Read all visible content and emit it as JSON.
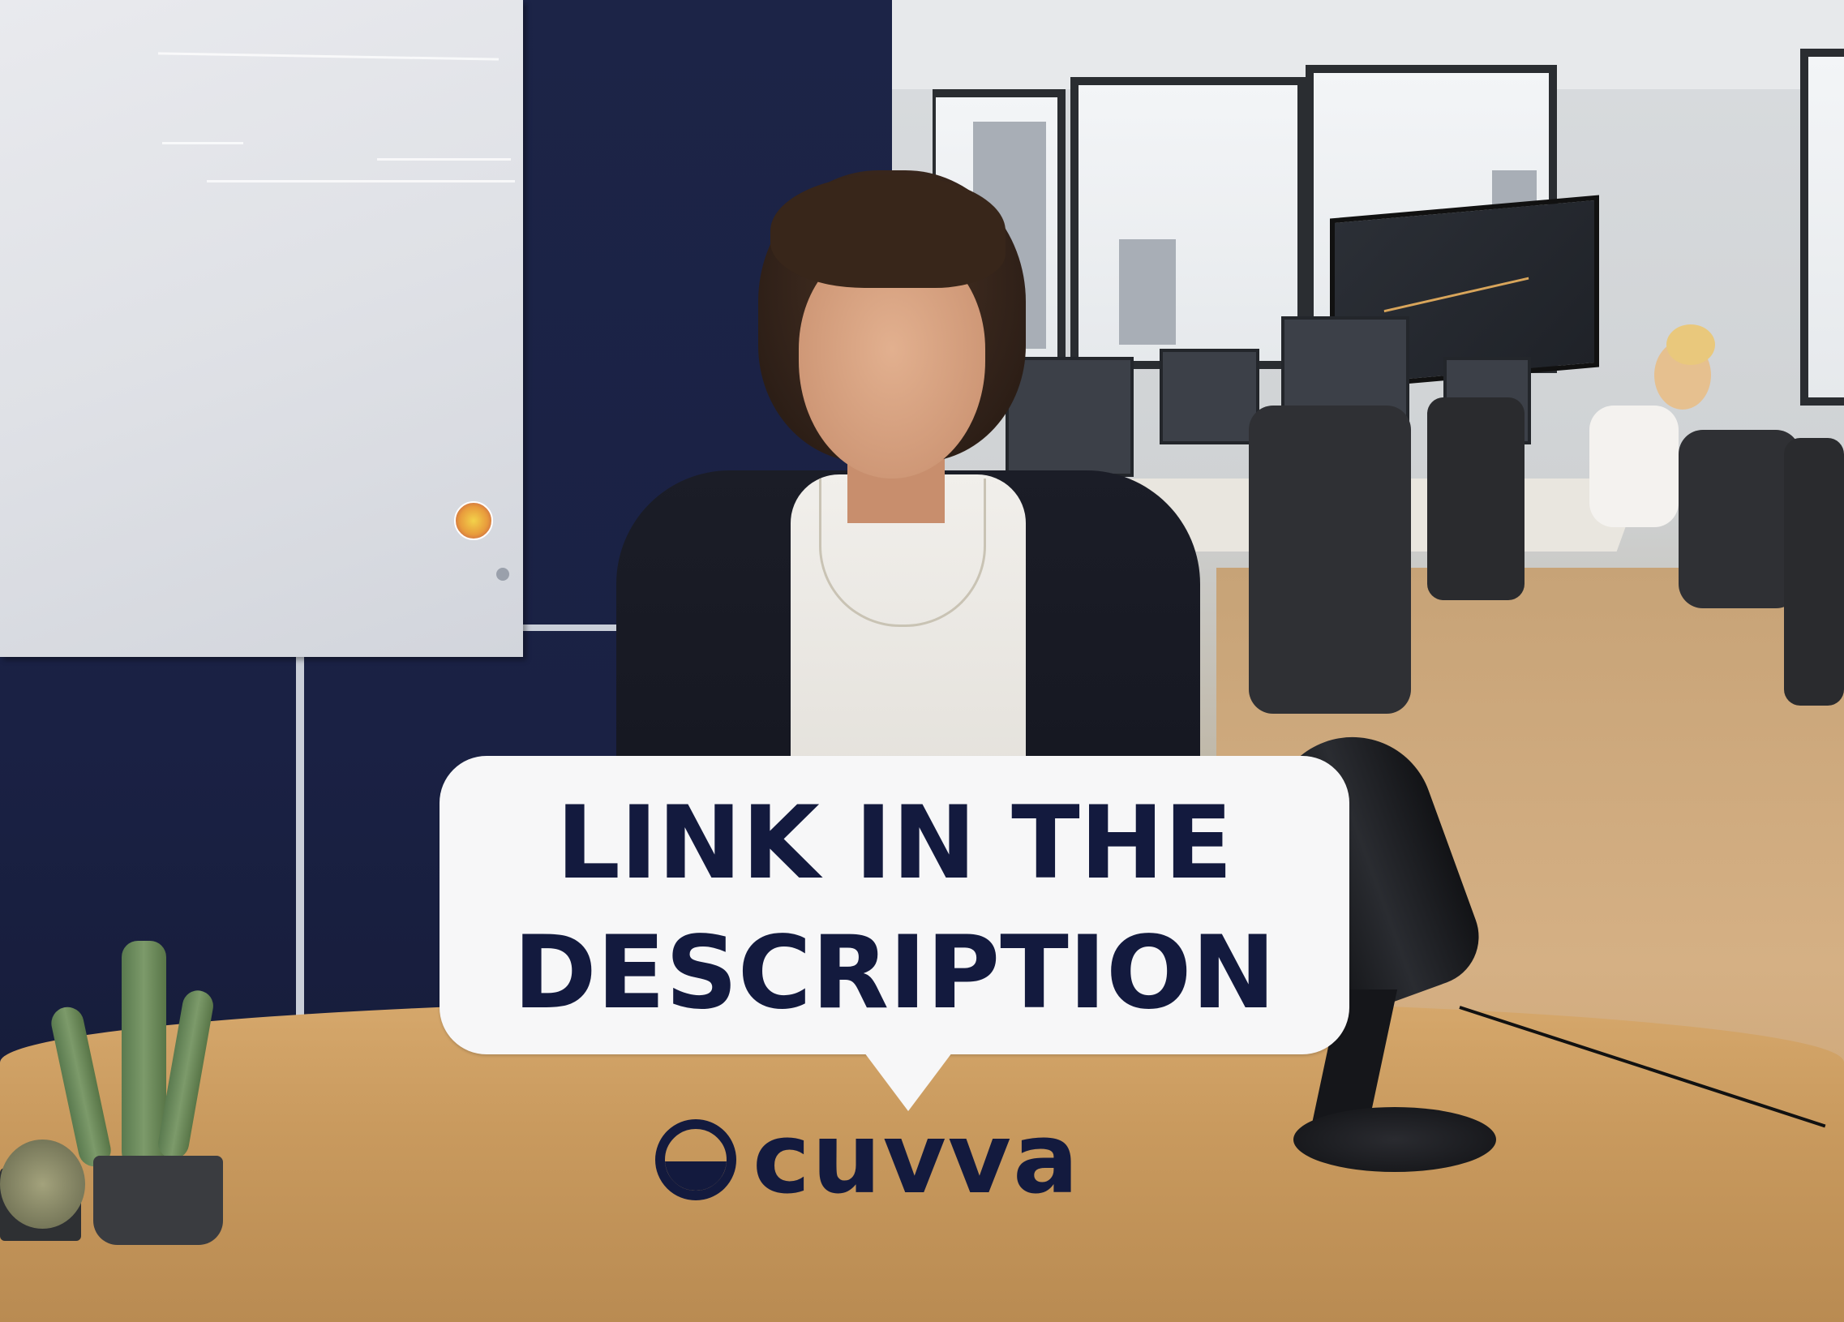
{
  "overlay": {
    "caption_lines": [
      "LINK IN THE",
      "DESCRIPTION"
    ]
  },
  "brand": {
    "name": "cuvva",
    "color": "#131a3e"
  },
  "colors": {
    "bubble_background": "#f7f7f8",
    "wall_navy": "#1c2447"
  }
}
